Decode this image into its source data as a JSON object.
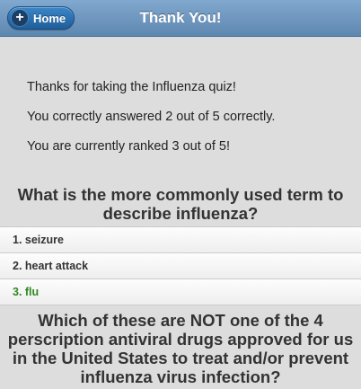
{
  "header": {
    "home_label": "Home",
    "title": "Thank You!"
  },
  "summary": {
    "thanks": "Thanks for taking the Influenza quiz!",
    "score": "You correctly answered 2 out of 5 correctly.",
    "rank": "You are currently ranked 3 out of 5!"
  },
  "questions": [
    {
      "text": "What is the more commonly used term to describe influenza?",
      "answers": [
        {
          "label": "1. seizure",
          "correct": false
        },
        {
          "label": "2. heart attack",
          "correct": false
        },
        {
          "label": "3. flu",
          "correct": true
        }
      ]
    },
    {
      "text": "Which of these are NOT one of the 4 perscription antiviral drugs approved for us in the United States to treat and/or prevent influenza virus infection?"
    }
  ],
  "colors": {
    "header_bg": "#6f97bf",
    "home_button": "#2a72b3",
    "correct_answer": "#2f8a1f",
    "page_bg": "#dddddd"
  },
  "icons": {
    "home_button_icon": "plus-icon"
  }
}
